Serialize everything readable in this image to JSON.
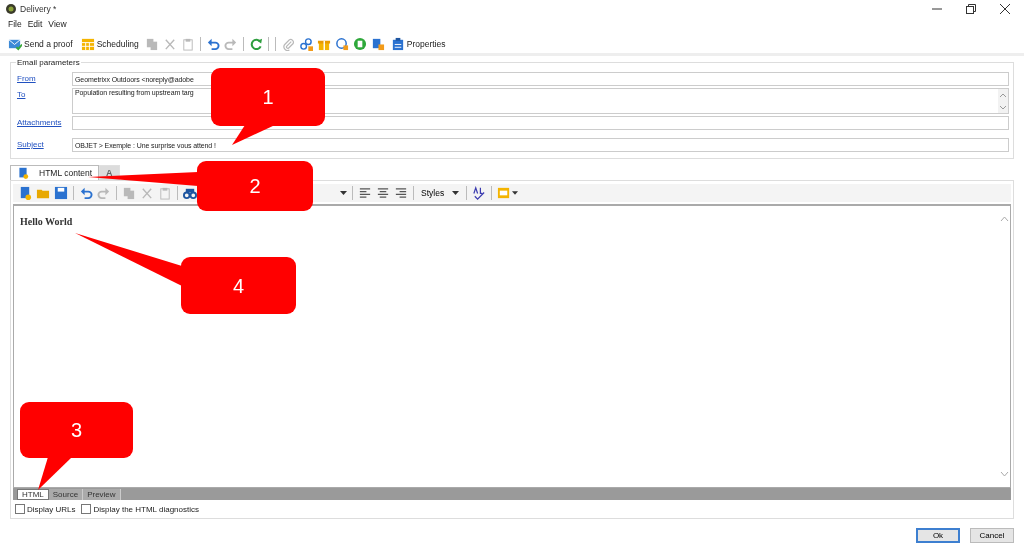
{
  "window": {
    "title": "Delivery *"
  },
  "menu": [
    "File",
    "Edit",
    "View"
  ],
  "toolbar": [
    {
      "kind": "send",
      "label": "Send a proof",
      "disabled": false
    },
    {
      "kind": "schedule",
      "label": "Scheduling",
      "disabled": false
    },
    {
      "kind": "copy",
      "disabled": true
    },
    {
      "kind": "cut",
      "disabled": true
    },
    {
      "kind": "paste",
      "disabled": true
    },
    {
      "kind": "sep"
    },
    {
      "kind": "undo",
      "disabled": false
    },
    {
      "kind": "redo",
      "disabled": true
    },
    {
      "kind": "sep"
    },
    {
      "kind": "refresh",
      "disabled": false
    },
    {
      "kind": "sep"
    },
    {
      "kind": "sep"
    },
    {
      "kind": "attach",
      "disabled": true
    },
    {
      "kind": "link",
      "disabled": false
    },
    {
      "kind": "gift",
      "disabled": false
    },
    {
      "kind": "target",
      "disabled": false
    },
    {
      "kind": "badge",
      "disabled": false
    },
    {
      "kind": "puzzle",
      "disabled": false
    },
    {
      "kind": "properties",
      "label": "Properties",
      "disabled": false
    }
  ],
  "email_parameters": {
    "title": "Email parameters",
    "fields": [
      {
        "label": "From",
        "kind": "line",
        "value": "Geometrixx Outdoors <noreply@adobe"
      },
      {
        "label": "To",
        "kind": "multiline",
        "value": "Population resulting from upstream targ"
      },
      {
        "label": "Attachments",
        "kind": "line"
      },
      {
        "label": "Subject",
        "kind": "line",
        "value": "OBJET > Exemple : Une surprise vous attend !"
      }
    ]
  },
  "tabs": [
    {
      "kind": "html",
      "label": "HTML content",
      "selected": true
    },
    {
      "kind": "text",
      "glyph": "A",
      "selected": false
    }
  ],
  "editor_toolbar": [
    {
      "kind": "newdoc",
      "disabled": false
    },
    {
      "kind": "folder",
      "disabled": false
    },
    {
      "kind": "save",
      "disabled": false
    },
    {
      "kind": "sep"
    },
    {
      "kind": "undo",
      "disabled": false
    },
    {
      "kind": "redo",
      "disabled": true
    },
    {
      "kind": "sep"
    },
    {
      "kind": "copy",
      "disabled": true
    },
    {
      "kind": "cut",
      "disabled": true
    },
    {
      "kind": "paste",
      "disabled": true
    },
    {
      "kind": "sep"
    },
    {
      "kind": "find",
      "disabled": false
    },
    {
      "kind": "sep"
    },
    {
      "kind": "caret"
    },
    {
      "kind": "sep"
    },
    {
      "kind": "alignleft",
      "disabled": false
    },
    {
      "kind": "aligncenter",
      "disabled": false
    },
    {
      "kind": "alignright",
      "disabled": false
    },
    {
      "kind": "sep"
    },
    {
      "kind": "dropdown",
      "label": "Styles"
    },
    {
      "kind": "sep"
    },
    {
      "kind": "spell",
      "disabled": false
    },
    {
      "kind": "sep"
    },
    {
      "kind": "color",
      "disabled": false
    }
  ],
  "editor": {
    "content": "Hello World"
  },
  "view_tabs": [
    {
      "label": "HTML",
      "selected": true
    },
    {
      "label": "Source",
      "selected": false
    },
    {
      "label": "Preview",
      "selected": false
    }
  ],
  "options": [
    {
      "label": "Display URLs",
      "checked": false
    },
    {
      "label": "Display the HTML diagnostics",
      "checked": false
    }
  ],
  "buttons": [
    {
      "label": "Ok",
      "default": true
    },
    {
      "label": "Cancel",
      "default": false
    }
  ],
  "callouts": [
    {
      "label": "1"
    },
    {
      "label": "2"
    },
    {
      "label": "3"
    },
    {
      "label": "4"
    }
  ]
}
